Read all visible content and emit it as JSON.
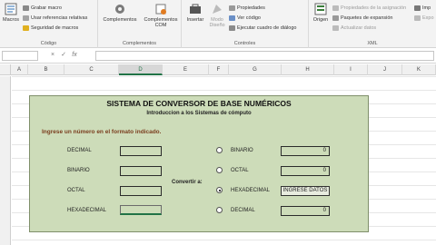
{
  "ribbon": {
    "code_group": {
      "label": "Código",
      "macros": "Macros",
      "record_macro": "Grabar macro",
      "relative_refs": "Usar referencias relativas",
      "macro_security": "Seguridad de macros"
    },
    "addins_group": {
      "label": "Complementos",
      "addins": "Complementos",
      "com_addins_1": "Complementos",
      "com_addins_2": "COM"
    },
    "controls_group": {
      "label": "Controles",
      "insert": "Insertar",
      "design_mode_1": "Modo",
      "design_mode_2": "Diseño",
      "properties": "Propiedades",
      "view_code": "Ver código",
      "run_dialog": "Ejecutar cuadro de diálogo"
    },
    "xml_group": {
      "label": "XML",
      "source": "Origen",
      "map_properties": "Propiedades de la asignación",
      "expansion_packs": "Paquetes de expansión",
      "refresh_data": "Actualizar datos",
      "import": "Imp",
      "export": "Expo"
    }
  },
  "formula_bar": {
    "cancel": "×",
    "enter": "✓",
    "fx": "fx",
    "formula": ""
  },
  "columns": [
    "A",
    "B",
    "C",
    "D",
    "E",
    "F",
    "G",
    "H",
    "I",
    "J",
    "K"
  ],
  "selected_column": "D",
  "form": {
    "title": "SISTEMA DE CONVERSOR DE BASE NUMÉRICOS",
    "subtitle": "Introduccion a los Sistemas de cómputo",
    "prompt": "Ingrese un número en el formato indicado.",
    "inputs": [
      {
        "label": "DECIMAL",
        "value": ""
      },
      {
        "label": "BINARIO",
        "value": ""
      },
      {
        "label": "OCTAL",
        "value": ""
      },
      {
        "label": "HEXADECIMAL",
        "value": ""
      }
    ],
    "convert_label": "Convertir a:",
    "outputs": [
      {
        "label": "BINARIO",
        "value": "0",
        "selected": false
      },
      {
        "label": "OCTAL",
        "value": "0",
        "selected": false
      },
      {
        "label": "HEXADECIMAL",
        "value": "INGRESE DATOS",
        "selected": true
      },
      {
        "label": "DECIMAL",
        "value": "0",
        "selected": false
      }
    ]
  },
  "colors": {
    "panel_bg": "#cddcb9",
    "prompt_text": "#7a3d1e",
    "excel_green": "#217346"
  }
}
